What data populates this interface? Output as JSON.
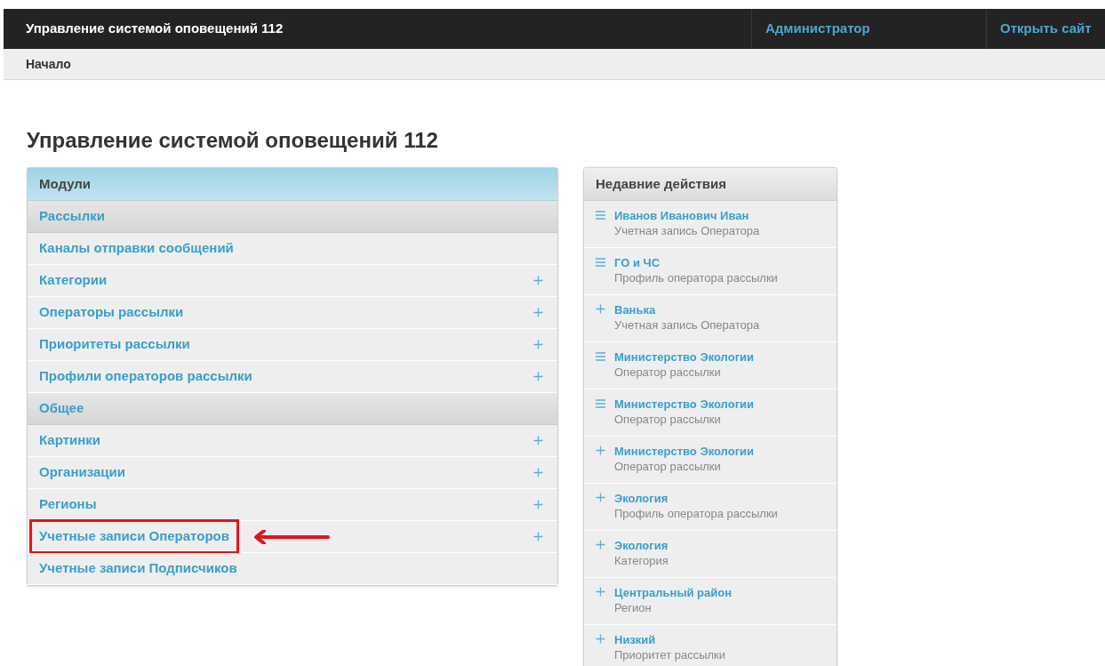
{
  "header": {
    "title": "Управление системой оповещений 112",
    "links": [
      "Администратор",
      "Открыть сайт"
    ]
  },
  "breadcrumbs": [
    "Начало"
  ],
  "page_title": "Управление системой оповещений 112",
  "modules": {
    "title": "Модули",
    "items": [
      {
        "kind": "section",
        "label": "Рассылки"
      },
      {
        "kind": "model",
        "label": "Каналы отправки сообщений",
        "addable": false,
        "highlighted": false
      },
      {
        "kind": "model",
        "label": "Категории",
        "addable": true,
        "highlighted": false
      },
      {
        "kind": "model",
        "label": "Операторы рассылки",
        "addable": true,
        "highlighted": false
      },
      {
        "kind": "model",
        "label": "Приоритеты рассылки",
        "addable": true,
        "highlighted": false
      },
      {
        "kind": "model",
        "label": "Профили операторов рассылки",
        "addable": true,
        "highlighted": false
      },
      {
        "kind": "section",
        "label": "Общее"
      },
      {
        "kind": "model",
        "label": "Картинки",
        "addable": true,
        "highlighted": false
      },
      {
        "kind": "model",
        "label": "Организации",
        "addable": true,
        "highlighted": false
      },
      {
        "kind": "model",
        "label": "Регионы",
        "addable": true,
        "highlighted": false
      },
      {
        "kind": "model",
        "label": "Учетные записи Операторов",
        "addable": true,
        "highlighted": true
      },
      {
        "kind": "model",
        "label": "Учетные записи Подписчиков",
        "addable": false,
        "highlighted": false
      }
    ]
  },
  "recent_actions": {
    "title": "Недавние действия",
    "items": [
      {
        "kind": "change",
        "name": "Иванов Иванович Иван",
        "type": "Учетная запись Оператора"
      },
      {
        "kind": "change",
        "name": "ГО и ЧС",
        "type": "Профиль оператора рассылки"
      },
      {
        "kind": "add",
        "name": "Ванька",
        "type": "Учетная запись Оператора"
      },
      {
        "kind": "change",
        "name": "Министерство Экологии",
        "type": "Оператор рассылки"
      },
      {
        "kind": "change",
        "name": "Министерство Экологии",
        "type": "Оператор рассылки"
      },
      {
        "kind": "add",
        "name": "Министерство Экологии",
        "type": "Оператор рассылки"
      },
      {
        "kind": "add",
        "name": "Экология",
        "type": "Профиль оператора рассылки"
      },
      {
        "kind": "add",
        "name": "Экология",
        "type": "Категория"
      },
      {
        "kind": "add",
        "name": "Центральный район",
        "type": "Регион"
      },
      {
        "kind": "add",
        "name": "Низкий",
        "type": "Приоритет рассылки"
      }
    ]
  }
}
